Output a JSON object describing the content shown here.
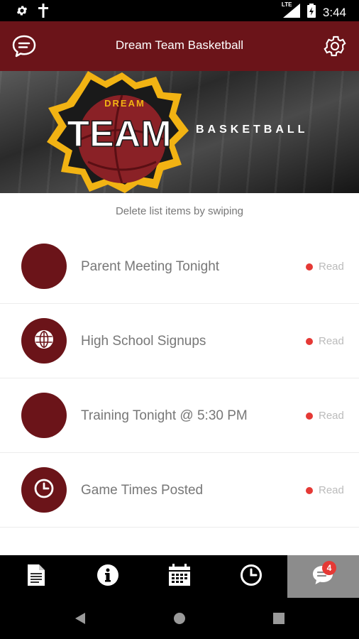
{
  "status_bar": {
    "time": "3:44",
    "network": "LTE"
  },
  "app_bar": {
    "title": "Dream Team Basketball"
  },
  "banner": {
    "logo_top": "DREAM",
    "logo_main": "TEAM",
    "text": "BASKETBALL"
  },
  "hint": "Delete list items by swiping",
  "messages": [
    {
      "title": "Parent Meeting Tonight",
      "status": "Read",
      "icon": "none"
    },
    {
      "title": "High School Signups",
      "status": "Read",
      "icon": "globe-icon"
    },
    {
      "title": "Training Tonight @ 5:30 PM",
      "status": "Read",
      "icon": "none"
    },
    {
      "title": "Game Times Posted",
      "status": "Read",
      "icon": "clock-icon"
    }
  ],
  "tabs": [
    {
      "icon": "document-icon"
    },
    {
      "icon": "info-icon"
    },
    {
      "icon": "calendar-icon"
    },
    {
      "icon": "clock-icon"
    },
    {
      "icon": "chat-icon",
      "badge": "4",
      "active": true
    }
  ],
  "colors": {
    "brand": "#6b1419",
    "unread_dot": "#e53935",
    "tab_active": "#8c8c8c"
  }
}
